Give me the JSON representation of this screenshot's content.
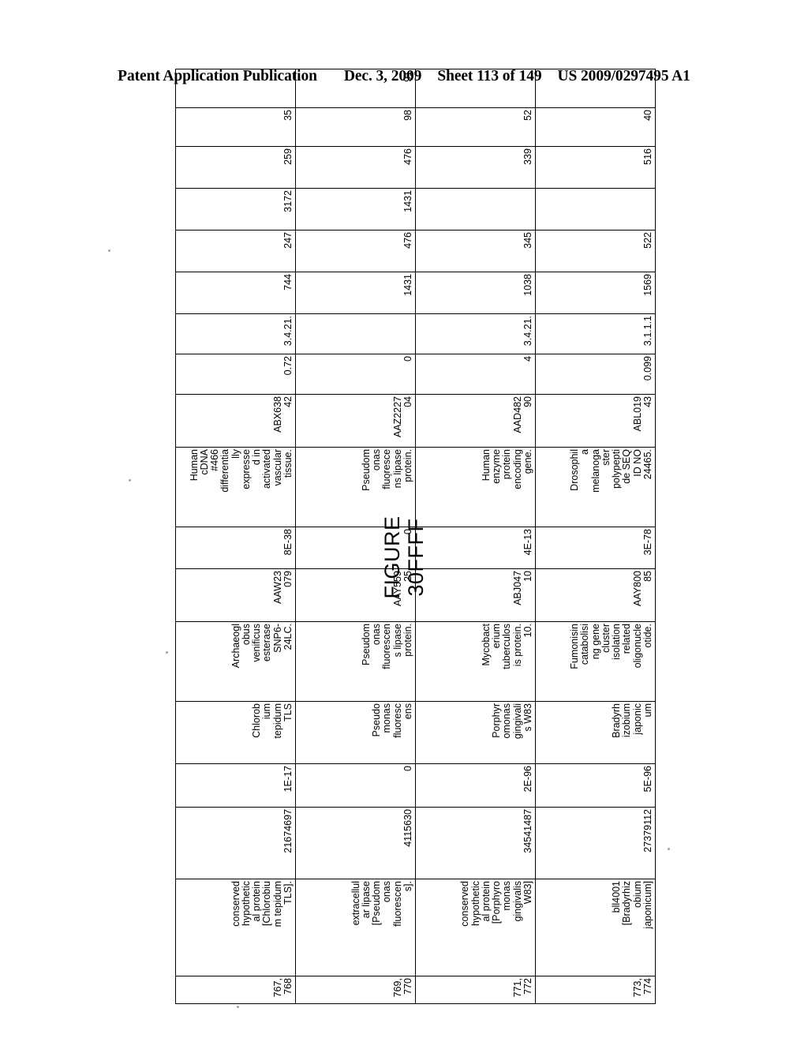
{
  "header": {
    "publication": "Patent Application Publication",
    "date": "Dec. 3, 2009",
    "sheet": "Sheet 113 of 149",
    "doc_number": "US 2009/0297495 A1"
  },
  "figure": {
    "caption_line1": "FIGURE",
    "caption_line2": "30FFFF"
  },
  "table": {
    "rows": [
      {
        "seq": "767,\n768",
        "name": "conserved\nhypothetic\nal protein\n[Chlorobiu\nm tepidum\nTLS].",
        "gi": "21674697",
        "evalue1": "1E-17",
        "organism": "Chlorob\nium\ntepidum\nTLS",
        "desc2": "Archaeogl\nobus\nvenificus\nesterase\nSNP6-\n24LC.",
        "acc2": "AAW23\n079",
        "evalue2": "8E-38",
        "desc3": "Human\ncDNA\n#466\ndifferentia\nlly\nexpresse\nd in\nactivated\nvascular\ntissue.",
        "acc3": "ABX638\n42",
        "score": "0.72",
        "ec": "3.4.21.",
        "n1": "744",
        "n2": "247",
        "n3": "3172",
        "n4": "259",
        "n5": "35",
        "n6": ""
      },
      {
        "seq": "769,\n770",
        "name": "extracellul\nar lipase\n[Pseudom\nonas\nfluorescen\ns].",
        "gi": "4115630",
        "evalue1": "0",
        "organism": "Pseudo\nmonas\nfluoresc\nens",
        "desc2": "Pseudom\nonas\nfluorescen\ns lipase\nprotein.",
        "acc2": "AAY559\n25",
        "evalue2": "0",
        "desc3": "Pseudom\nonas\nfluoresce\nns lipase\nprotein.",
        "acc3": "AAZ2227\n04",
        "score": "0",
        "ec": "",
        "n1": "1431",
        "n2": "476",
        "n3": "1431",
        "n4": "476",
        "n5": "98",
        "n6": "91"
      },
      {
        "seq": "771,\n772",
        "name": "conserved\nhypothetic\nal protein\n[Porphyro\nmonas\ngingivalis\nW83]",
        "gi": "34541487",
        "evalue1": "2E-96",
        "organism": "Porphyr\nomonas\ngingivali\ns W83",
        "desc2": "Mycobact\nerium\ntuberculos\nis protein.\n10.",
        "acc2": "ABJ047\n10",
        "evalue2": "4E-13",
        "desc3": "Human\nenzyme\nprotein\nencoding\ngene.",
        "acc3": "AAD482\n90",
        "score": "4",
        "ec": "3.4.21.",
        "n1": "1038",
        "n2": "345",
        "n3": "",
        "n4": "339",
        "n5": "52",
        "n6": ""
      },
      {
        "seq": "773,\n774",
        "name": "bll4001\n[Bradyrhiz\nobium\njaponicum]",
        "gi": "27379112",
        "evalue1": "5E-96",
        "organism": "Bradyrh\nizobium\njaponic\num",
        "desc2": "Fumonisin\ncatabolisi\nng gene\ncluster\nisolation\nrelated\noligonucle\notide.",
        "acc2": "AAY800\n85",
        "evalue2": "3E-78",
        "desc3": "Drosophil\na\nmelanoga\nster\npolypepti\nde SEQ\nID NO\n24465.",
        "acc3": "ABL019\n43",
        "score": "0.099",
        "ec": "3.1.1.1",
        "n1": "1569",
        "n2": "522",
        "n3": "",
        "n4": "516",
        "n5": "40",
        "n6": ""
      }
    ]
  }
}
